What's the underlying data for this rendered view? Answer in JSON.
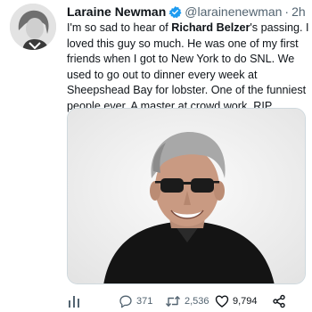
{
  "tweet": {
    "author": {
      "display_name": "Laraine Newman",
      "handle": "@larainenewman",
      "verified": true
    },
    "separator": "·",
    "time": "2h",
    "text": {
      "part1": "I'm so sad to hear of ",
      "mention": "Richard Belzer",
      "part2": "'s passing. I loved this guy so much. He was one of my first friends when I got to New York to do SNL. We used to go out to dinner every week at Sheepshead Bay for lobster. One of the funniest people ever. A master at crowd work. RIP dearest."
    },
    "actions": {
      "analytics_icon": "bar-chart-icon",
      "reply_icon": "reply-icon",
      "reply_count": "371",
      "retweet_icon": "retweet-icon",
      "retweet_count": "2,536",
      "like_icon": "heart-icon",
      "like_count": "9,794",
      "share_icon": "share-icon"
    },
    "colors": {
      "verified": "#1d9bf0",
      "secondary_text": "#536471",
      "primary_text": "#0f1419"
    }
  }
}
